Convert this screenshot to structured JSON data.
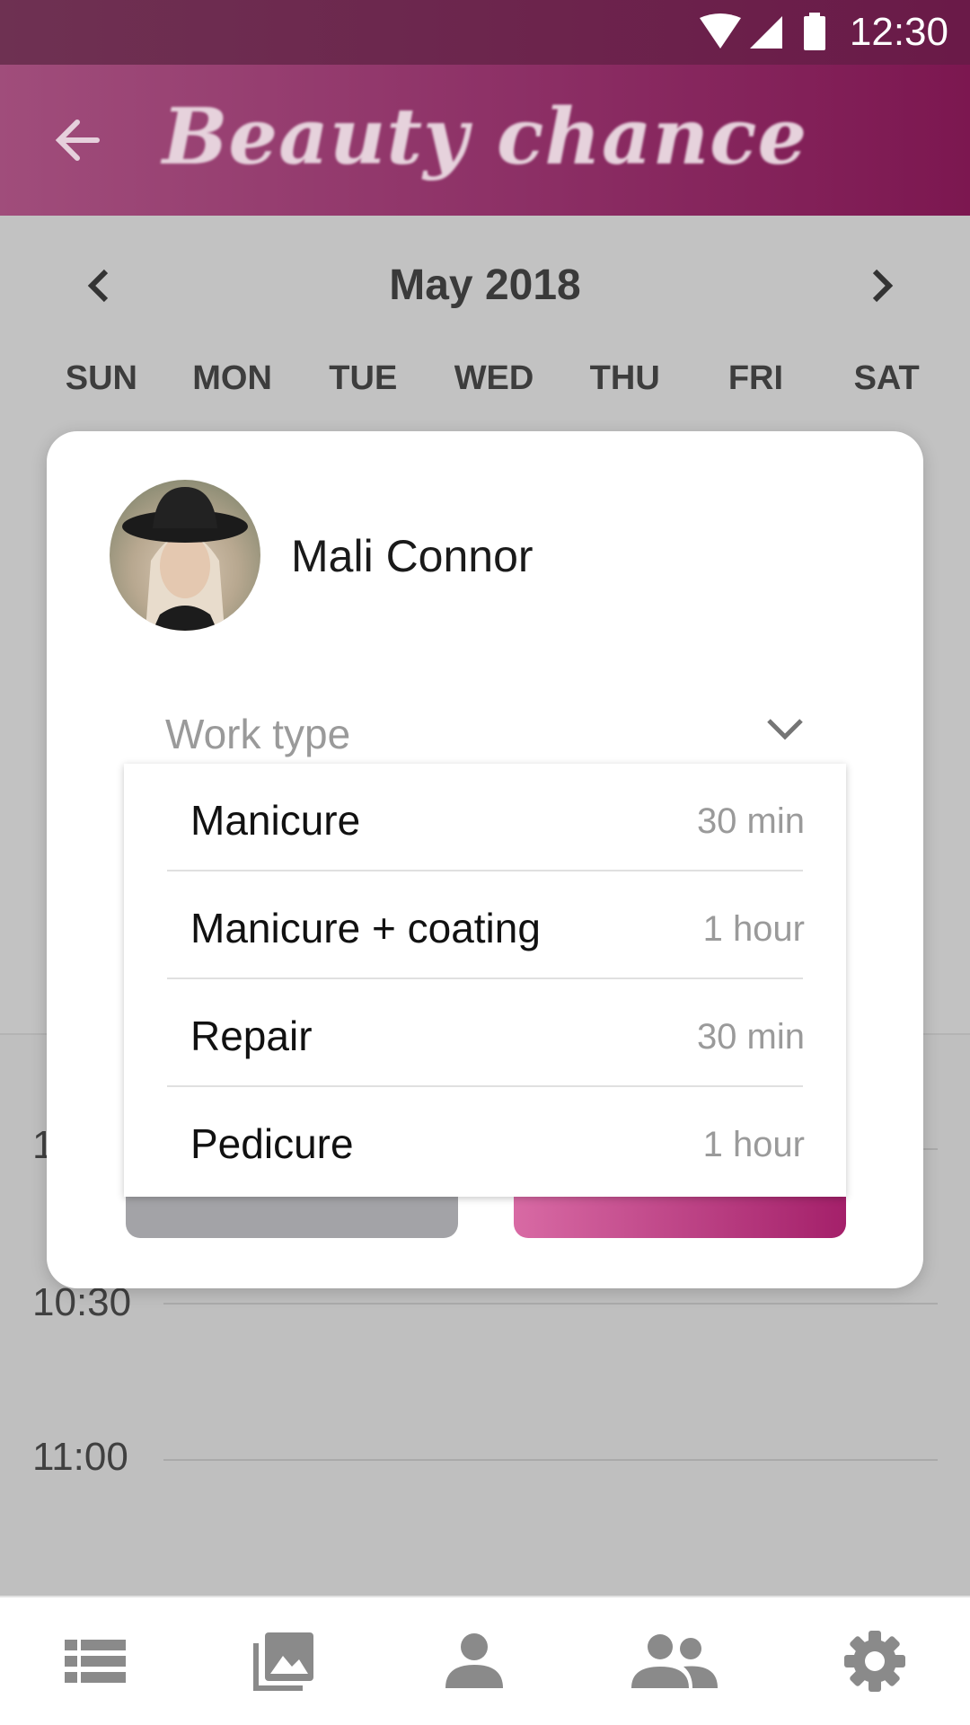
{
  "status_bar": {
    "time": "12:30"
  },
  "app_bar": {
    "title": "Beauty chance"
  },
  "calendar": {
    "month": "May 2018",
    "weekdays": [
      "SUN",
      "MON",
      "TUE",
      "WED",
      "THU",
      "FRI",
      "SAT"
    ],
    "times": [
      "1",
      "10:30",
      "11:00"
    ]
  },
  "dialog": {
    "user_name": "Mali Connor",
    "work_type_placeholder": "Work type",
    "options": [
      {
        "name": "Manicure",
        "duration": "30 min"
      },
      {
        "name": "Manicure + coating",
        "duration": "1 hour"
      },
      {
        "name": "Repair",
        "duration": "30 min"
      },
      {
        "name": "Pedicure",
        "duration": "1 hour"
      }
    ]
  },
  "bottom_nav": {
    "items": [
      "list-icon",
      "gallery-icon",
      "person-icon",
      "group-icon",
      "settings-icon"
    ]
  },
  "colors": {
    "app_bar": "#8c2f65",
    "accent": "#a4206a",
    "overlay": "#bfbfbf"
  }
}
